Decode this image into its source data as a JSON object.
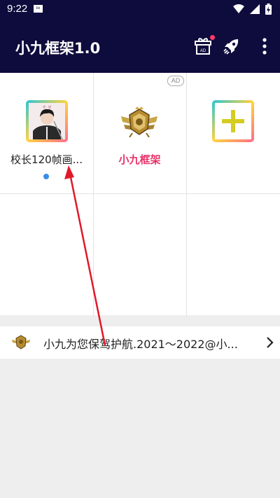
{
  "status_bar": {
    "time": "9:22",
    "notif_text": "kk"
  },
  "app_bar": {
    "title": "小九框架1.0",
    "gift_badge_text": "AD"
  },
  "grid": {
    "ad_badge": "AD",
    "items": [
      {
        "label": "校长120帧画...",
        "avatar_caption": "肖 · 战"
      },
      {
        "label": "小九框架"
      },
      {
        "label": ""
      }
    ]
  },
  "banner": {
    "text": "小九为您保驾护航.2021～2022@小..."
  },
  "colors": {
    "app_bar_bg": "#0e0c3d",
    "accent_pink": "#e8336a",
    "indicator_blue": "#3a8ce8",
    "annotation_red": "#e0192a"
  }
}
